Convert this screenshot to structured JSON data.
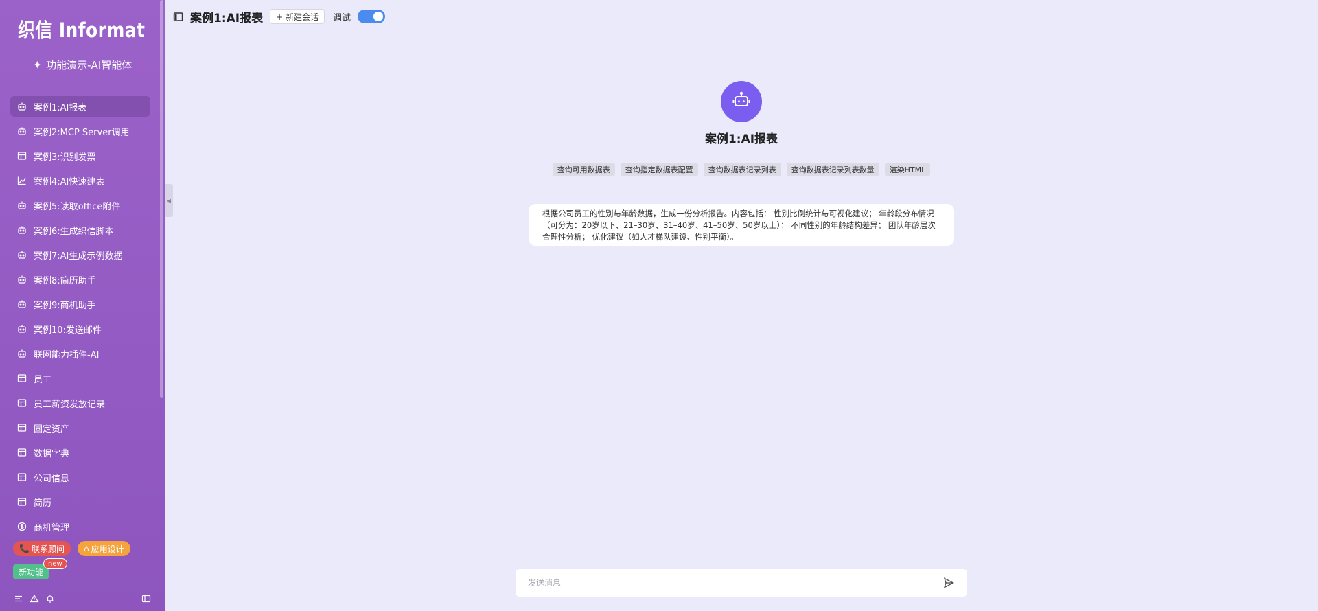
{
  "sidebar": {
    "logo_text": "织信 Informat",
    "app_title": "功能演示-AI智能体",
    "items": [
      {
        "label": "案例1:AI报表",
        "icon": "robot-icon",
        "active": true
      },
      {
        "label": "案例2:MCP Server调用",
        "icon": "robot-icon"
      },
      {
        "label": "案例3:识别发票",
        "icon": "table-icon"
      },
      {
        "label": "案例4:AI快速建表",
        "icon": "line-chart-icon"
      },
      {
        "label": "案例5:读取office附件",
        "icon": "robot-icon"
      },
      {
        "label": "案例6:生成织信脚本",
        "icon": "robot-icon"
      },
      {
        "label": "案例7:AI生成示例数据",
        "icon": "robot-icon"
      },
      {
        "label": "案例8:简历助手",
        "icon": "robot-icon"
      },
      {
        "label": "案例9:商机助手",
        "icon": "robot-icon"
      },
      {
        "label": "案例10:发送邮件",
        "icon": "robot-icon"
      },
      {
        "label": "联网能力插件-AI",
        "icon": "robot-icon"
      },
      {
        "label": "员工",
        "icon": "table-icon"
      },
      {
        "label": "员工薪资发放记录",
        "icon": "table-icon"
      },
      {
        "label": "固定资产",
        "icon": "table-icon"
      },
      {
        "label": "数据字典",
        "icon": "table-icon"
      },
      {
        "label": "公司信息",
        "icon": "table-icon"
      },
      {
        "label": "简历",
        "icon": "table-icon"
      },
      {
        "label": "商机管理",
        "icon": "dollar-icon"
      }
    ],
    "contact_label": "联系顾问",
    "design_label": "应用设计",
    "new_feature_label": "新功能",
    "new_badge": "new"
  },
  "header": {
    "title": "案例1:AI报表",
    "new_chat_label": "+ 新建会话",
    "debug_label": "调试",
    "debug_on": true
  },
  "agent": {
    "name": "案例1:AI报表",
    "tools": [
      "查询可用数据表",
      "查询指定数据表配置",
      "查询数据表记录列表",
      "查询数据表记录列表数量",
      "渲染HTML"
    ],
    "suggested_prompt": "根据公司员工的性别与年龄数据，生成一份分析报告。内容包括： 性别比例统计与可视化建议； 年龄段分布情况（可分为：20岁以下、21–30岁、31–40岁、41–50岁、50岁以上）； 不同性别的年龄结构差异； 团队年龄层次合理性分析； 优化建议（如人才梯队建设、性别平衡）。"
  },
  "composer": {
    "placeholder": "发送消息"
  },
  "colors": {
    "sidebar": "#9b62c9",
    "accent": "#7b5ef0",
    "toggle": "#4b8bf0",
    "background": "#eaeafb"
  }
}
